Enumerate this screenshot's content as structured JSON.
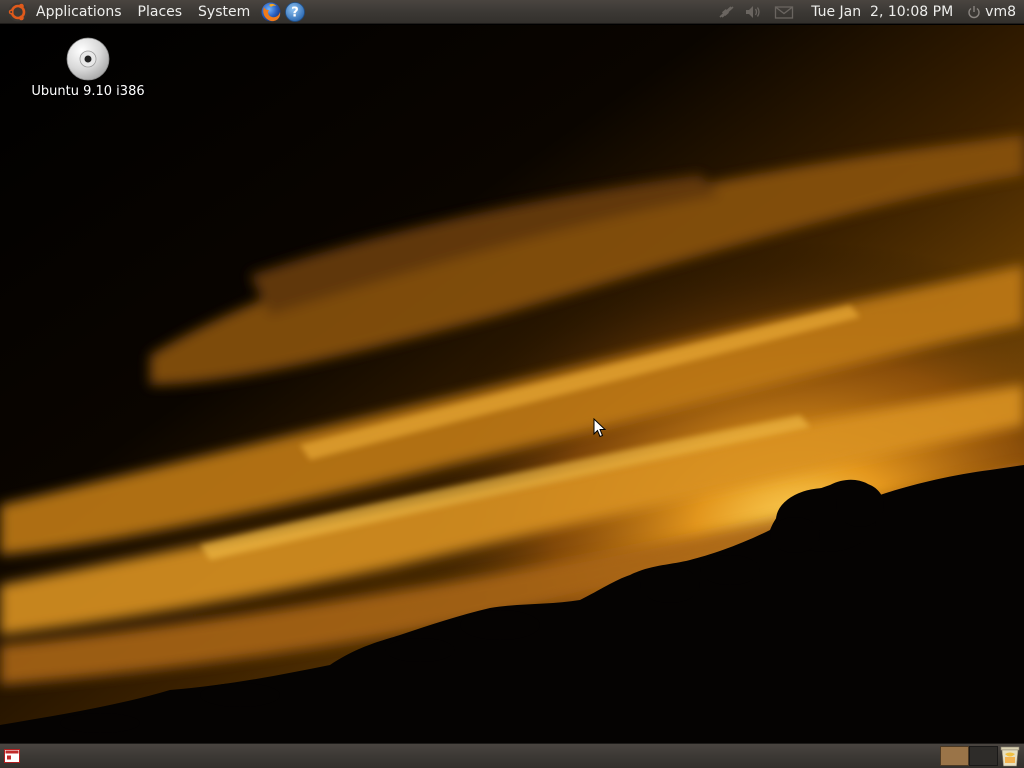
{
  "top_panel": {
    "menus": {
      "applications": "Applications",
      "places": "Places",
      "system": "System"
    },
    "launchers": [
      "firefox-icon",
      "help-icon"
    ],
    "tray": [
      "network-icon",
      "volume-icon",
      "mail-icon"
    ],
    "clock": "Tue Jan  2, 10:08 PM",
    "user": "vm8"
  },
  "desktop": {
    "icons": [
      {
        "label": "Ubuntu 9.10 i386",
        "icon": "cdrom-icon"
      }
    ]
  },
  "bottom_panel": {
    "workspaces": 2,
    "active_workspace": 1,
    "items": [
      "show-desktop-icon",
      "workspace-switcher",
      "trash-icon"
    ]
  },
  "colors": {
    "panel": "#3c3935",
    "panel_text": "#eeeeec",
    "ubuntu_orange": "#dd4814",
    "workspace_active": "#9a7448"
  }
}
